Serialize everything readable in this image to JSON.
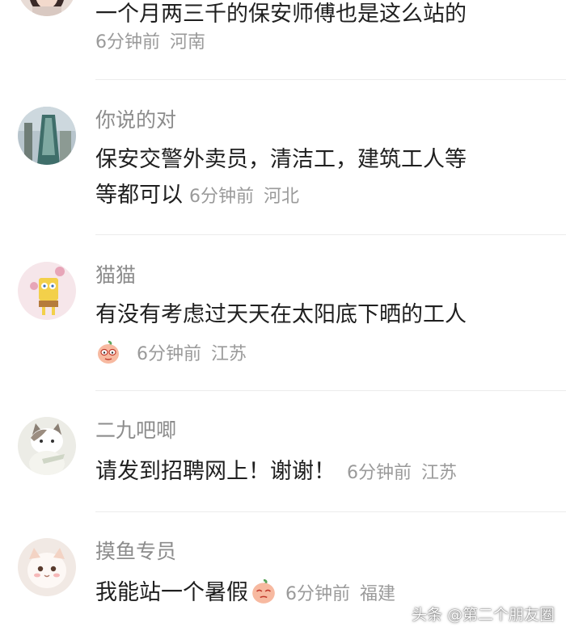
{
  "comments": [
    {
      "text": "一个月两三千的保安师傅也是这么站的",
      "time": "6分钟前",
      "location": "河南"
    },
    {
      "username": "你说的对",
      "text_line1": "保安交警外卖员，清洁工，建筑工人等",
      "text_line2": "等都可以",
      "time": "6分钟前",
      "location": "河北"
    },
    {
      "username": "猫猫",
      "text": "有没有考虑过天天在太阳底下晒的工人",
      "emoji": "peach-face-emoji",
      "time": "6分钟前",
      "location": "江苏"
    },
    {
      "username": "二九吧唧",
      "text": "请发到招聘网上！谢谢！",
      "time": "6分钟前",
      "location": "江苏"
    },
    {
      "username": "摸鱼专员",
      "text": "我能站一个暑假",
      "emoji": "peach-face-emoji",
      "time": "6分钟前",
      "location": "福建"
    }
  ],
  "watermark": "头条 @第二个朋友圈"
}
